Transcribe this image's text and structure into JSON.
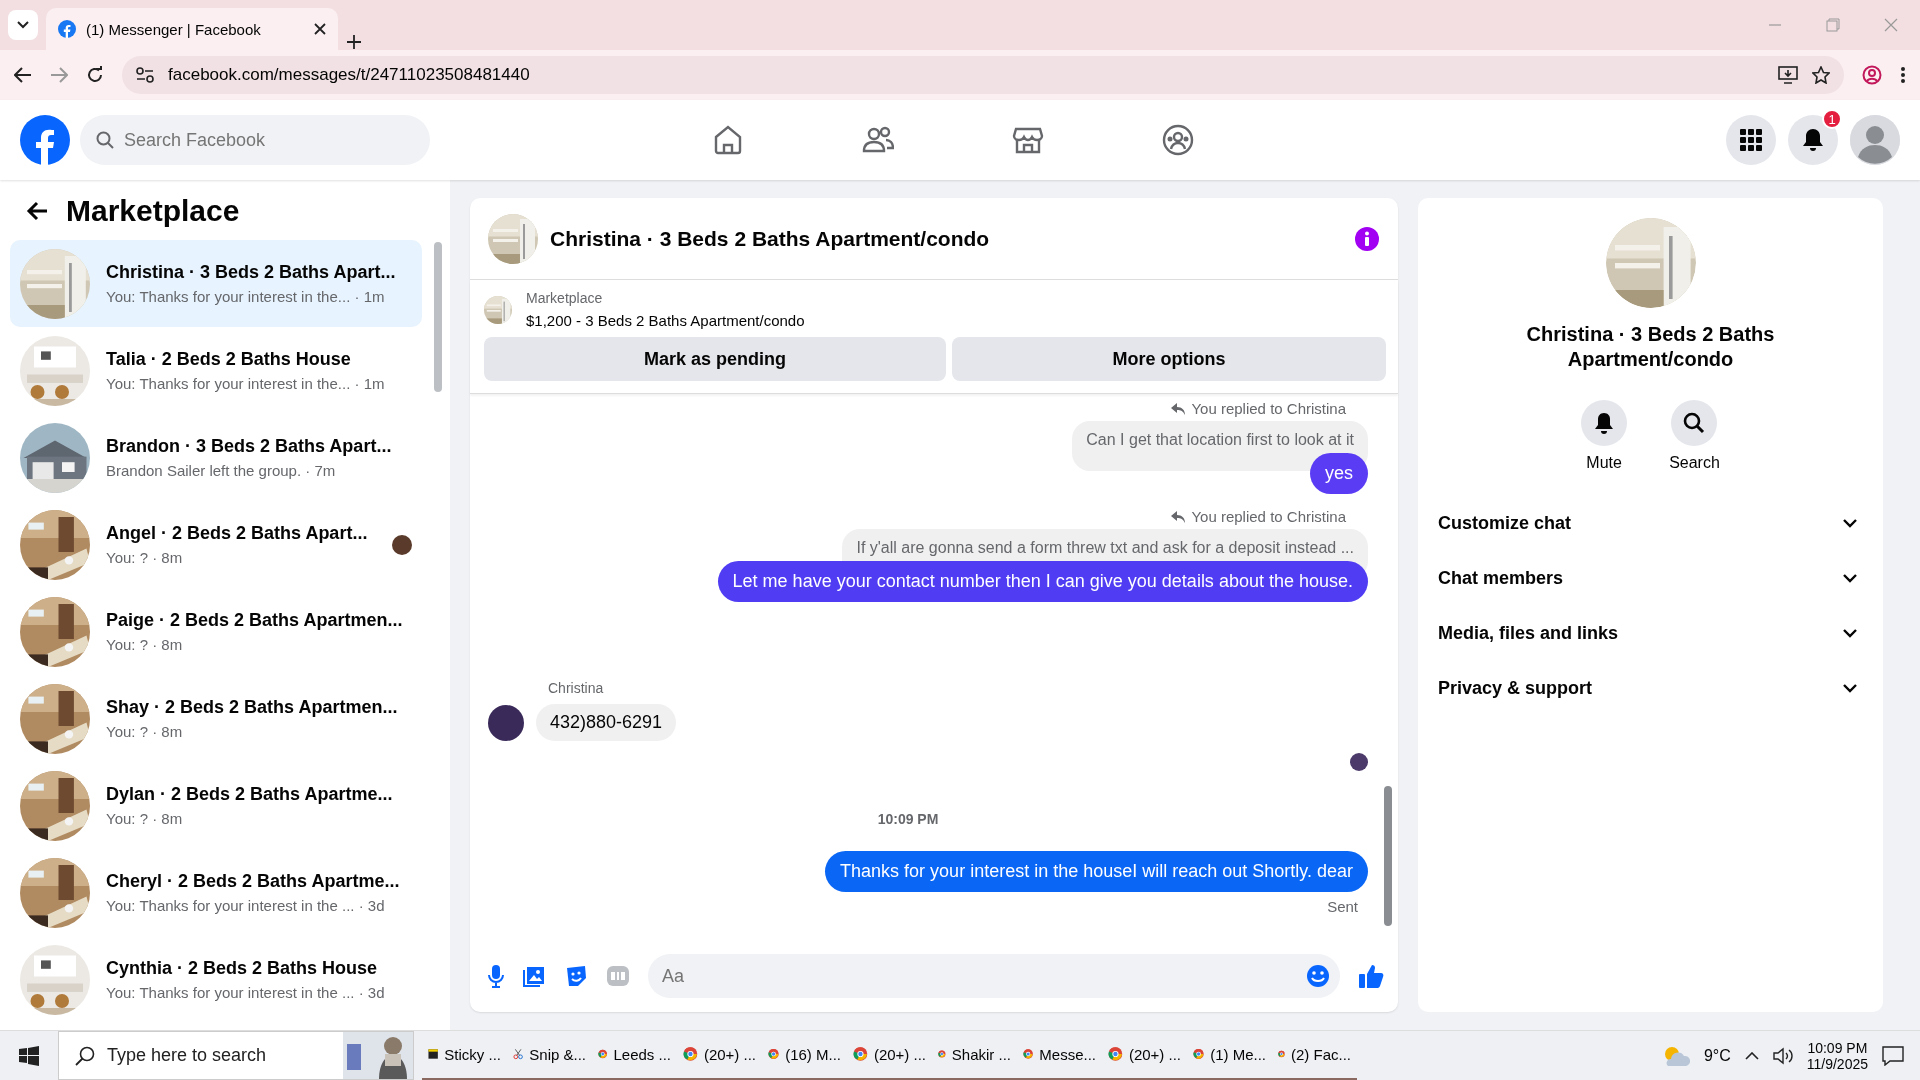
{
  "browser": {
    "tabs": [
      {
        "title": "(1) Messenger | Facebook",
        "selected": true
      }
    ],
    "url": "facebook.com/messages/t/24711023508481440"
  },
  "header": {
    "search": {
      "placeholder": "Search Facebook"
    },
    "notification_count": "1"
  },
  "sidebar": {
    "title": "Marketplace",
    "conversations": [
      {
        "name": "Christina · 3 Beds 2 Baths Apart...",
        "preview": "You: Thanks for your interest in the... · 1m",
        "selected": true,
        "seen": false
      },
      {
        "name": "Talia · 2 Beds 2 Baths House",
        "preview": "You: Thanks for your interest in the... · 1m",
        "selected": false,
        "seen": false
      },
      {
        "name": "Brandon · 3 Beds 2 Baths Apart...",
        "preview": "Brandon Sailer left the group. · 7m",
        "selected": false,
        "seen": false
      },
      {
        "name": "Angel · 2 Beds 2 Baths Apart...",
        "preview": "You: ? · 8m",
        "selected": false,
        "seen": true
      },
      {
        "name": "Paige · 2 Beds 2 Baths Apartmen...",
        "preview": "You: ? · 8m",
        "selected": false,
        "seen": false
      },
      {
        "name": "Shay · 2 Beds 2 Baths Apartmen...",
        "preview": "You: ? · 8m",
        "selected": false,
        "seen": false
      },
      {
        "name": "Dylan · 2 Beds 2 Baths Apartme...",
        "preview": "You: ? · 8m",
        "selected": false,
        "seen": false
      },
      {
        "name": "Cheryl · 2 Beds 2 Baths Apartme...",
        "preview": "You: Thanks for your interest in the ... · 3d",
        "selected": false,
        "seen": false
      },
      {
        "name": "Cynthia · 2 Beds 2 Baths House",
        "preview": "You: Thanks for your interest in the ... · 3d",
        "selected": false,
        "seen": false
      }
    ]
  },
  "chat": {
    "title": "Christina · 3 Beds 2 Baths Apartment/condo",
    "listing": {
      "label": "Marketplace",
      "title": "$1,200 - 3 Beds 2 Baths Apartment/condo",
      "buttons": [
        "Mark as pending",
        "More options"
      ]
    },
    "messages": [
      {
        "kind": "reply_note",
        "text": "You replied to Christina"
      },
      {
        "kind": "quoted",
        "text": "Can I get that location first to look at it"
      },
      {
        "kind": "outgoing",
        "text": "yes",
        "color": "#5b3cf5"
      },
      {
        "kind": "reply_note",
        "text": "You replied to Christina"
      },
      {
        "kind": "quoted",
        "text": "If y'all  are gonna send a form threw txt and ask for a deposit instead ..."
      },
      {
        "kind": "outgoing",
        "text": "Let me have your contact number then I can give you details about the house.",
        "color": "#4f3cf3"
      },
      {
        "kind": "sender",
        "text": "Christina"
      },
      {
        "kind": "incoming",
        "text": "432)880-6291"
      },
      {
        "kind": "seen"
      },
      {
        "kind": "time",
        "text": "10:09 PM"
      },
      {
        "kind": "outgoing",
        "text": "Thanks for your interest in the houseI will reach out Shortly. dear",
        "color": "#0a66f5"
      },
      {
        "kind": "status",
        "text": "Sent"
      }
    ],
    "composer": {
      "placeholder": "Aa"
    }
  },
  "details": {
    "title": "Christina · 3 Beds 2 Baths Apartment/condo",
    "actions": [
      {
        "kind": "mute",
        "label": "Mute"
      },
      {
        "kind": "search",
        "label": "Search"
      }
    ],
    "sections": [
      {
        "label": "Customize chat",
        "expanded": false
      },
      {
        "label": "Chat members",
        "expanded": false
      },
      {
        "label": "Media, files and links",
        "expanded": false
      },
      {
        "label": "Privacy & support",
        "expanded": false
      }
    ]
  },
  "taskbar": {
    "search": {
      "placeholder": "Type here to search"
    },
    "apps": [
      {
        "kind": "notes",
        "label": "Sticky ..."
      },
      {
        "kind": "snip",
        "label": "Snip &..."
      },
      {
        "kind": "browser",
        "label": "Leeds ..."
      },
      {
        "kind": "browser",
        "label": "(20+) ..."
      },
      {
        "kind": "browser",
        "label": "(16) M..."
      },
      {
        "kind": "browser",
        "label": "(20+) ..."
      },
      {
        "kind": "browser",
        "label": "Shakir ..."
      },
      {
        "kind": "browser",
        "label": "Messe..."
      },
      {
        "kind": "browser",
        "label": "(20+) ..."
      },
      {
        "kind": "browser",
        "label": "(1) Me..."
      },
      {
        "kind": "browser",
        "label": "(2) Fac..."
      }
    ],
    "weather": "9°C",
    "time": "10:09 PM",
    "date": "11/9/2025"
  }
}
